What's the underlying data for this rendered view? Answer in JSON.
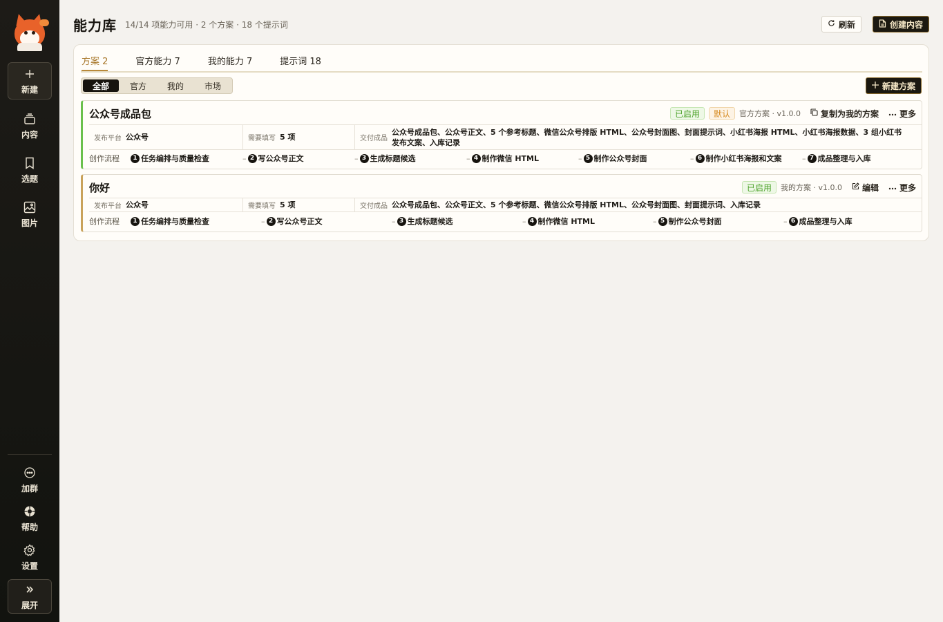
{
  "sidebar": {
    "new_label": "新建",
    "items": [
      {
        "label": "内容"
      },
      {
        "label": "选题"
      },
      {
        "label": "图片"
      }
    ],
    "bottom": [
      {
        "label": "加群"
      },
      {
        "label": "帮助"
      },
      {
        "label": "设置"
      }
    ],
    "expand_label": "展开"
  },
  "header": {
    "title": "能力库",
    "subtitle": "14/14 项能力可用 · 2 个方案 · 18 个提示词",
    "refresh_label": "刷新",
    "create_label": "创建内容"
  },
  "tabs": [
    {
      "label": "方案 2"
    },
    {
      "label": "官方能力 7"
    },
    {
      "label": "我的能力 7"
    },
    {
      "label": "提示词 18"
    }
  ],
  "filters": [
    {
      "label": "全部"
    },
    {
      "label": "官方"
    },
    {
      "label": "我的"
    },
    {
      "label": "市场"
    }
  ],
  "new_plan_label": "新建方案",
  "plans": [
    {
      "title": "公众号成品包",
      "badge_enabled": "已启用",
      "badge_default": "默认",
      "meta": "官方方案 · v1.0.0",
      "action_label": "复制为我的方案",
      "more_label": "更多",
      "platform_key": "发布平台",
      "platform_val": "公众号",
      "fill_key": "需要填写",
      "fill_val": "5 项",
      "deliver_key": "交付成品",
      "deliver_val": "公众号成品包、公众号正文、5 个参考标题、微信公众号排版 HTML、公众号封面图、封面提示词、小红书海报 HTML、小红书海报数据、3 组小红书发布文案、入库记录",
      "flow_label": "创作流程",
      "steps": [
        {
          "n": "1",
          "label": "任务编排与质量检查"
        },
        {
          "n": "2",
          "label": "写公众号正文"
        },
        {
          "n": "3",
          "label": "生成标题候选"
        },
        {
          "n": "4",
          "label": "制作微信 HTML"
        },
        {
          "n": "5",
          "label": "制作公众号封面"
        },
        {
          "n": "6",
          "label": "制作小红书海报和文案"
        },
        {
          "n": "7",
          "label": "成品整理与入库"
        }
      ]
    },
    {
      "title": "你好",
      "badge_enabled": "已启用",
      "meta": "我的方案 · v1.0.0",
      "action_label": "编辑",
      "more_label": "更多",
      "platform_key": "发布平台",
      "platform_val": "公众号",
      "fill_key": "需要填写",
      "fill_val": "5 项",
      "deliver_key": "交付成品",
      "deliver_val": "公众号成品包、公众号正文、5 个参考标题、微信公众号排版 HTML、公众号封面图、封面提示词、入库记录",
      "flow_label": "创作流程",
      "steps": [
        {
          "n": "1",
          "label": "任务编排与质量检查"
        },
        {
          "n": "2",
          "label": "写公众号正文"
        },
        {
          "n": "3",
          "label": "生成标题候选"
        },
        {
          "n": "4",
          "label": "制作微信 HTML"
        },
        {
          "n": "5",
          "label": "制作公众号封面"
        },
        {
          "n": "6",
          "label": "成品整理与入库"
        }
      ]
    }
  ],
  "colors": {
    "sidebar_bg": "#1d1b17",
    "accent": "#b8893a",
    "enabled_green": "#4da22b",
    "default_orange": "#d68a1f"
  }
}
